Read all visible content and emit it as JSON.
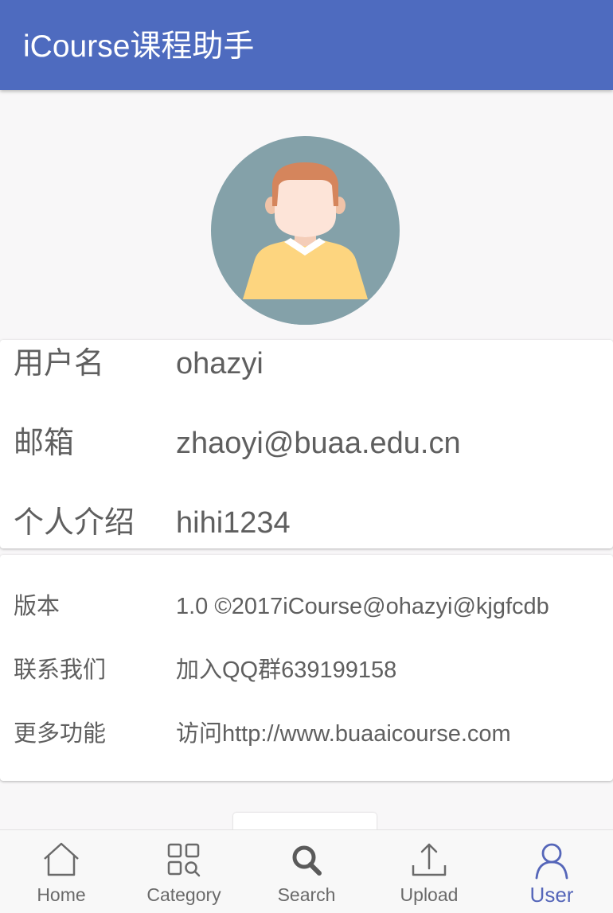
{
  "app_bar": {
    "title": "iCourse课程助手",
    "background": "#4e6bbf"
  },
  "profile": {
    "avatar_icon": "user-avatar-icon",
    "rows": [
      {
        "label": "用户名",
        "value": "ohazyi"
      },
      {
        "label": "邮箱",
        "value": "zhaoyi@buaa.edu.cn"
      },
      {
        "label": "个人介绍",
        "value": "hihi1234"
      }
    ]
  },
  "info": {
    "rows": [
      {
        "label": "版本",
        "value": "1.0 ©2017iCourse@ohazyi@kjgfcdb"
      },
      {
        "label": "联系我们",
        "value": "加入QQ群639199158"
      },
      {
        "label": "更多功能",
        "value": "访问http://www.buaaicourse.com"
      }
    ]
  },
  "bottom_nav": {
    "active_color": "#5566b9",
    "items": [
      {
        "label": "Home",
        "icon": "home-icon",
        "active": false
      },
      {
        "label": "Category",
        "icon": "category-icon",
        "active": false
      },
      {
        "label": "Search",
        "icon": "search-icon",
        "active": false
      },
      {
        "label": "Upload",
        "icon": "upload-icon",
        "active": false
      },
      {
        "label": "User",
        "icon": "user-icon",
        "active": true
      }
    ]
  }
}
